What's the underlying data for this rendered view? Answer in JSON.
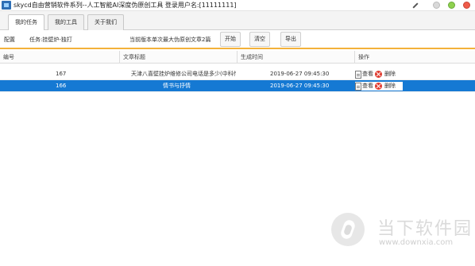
{
  "window": {
    "title": "skycd自由营销软件系列--人工智能AI深度伪原创工具 登录用户名:[11111111]"
  },
  "tabs": [
    {
      "label": "我的任务"
    },
    {
      "label": "我的工具"
    },
    {
      "label": "关于我们"
    }
  ],
  "toolbar": {
    "config_label": "配置",
    "task_label": "任务:挂壁炉-独打",
    "info_text": "当前版本单次最大伪原创文章2篇",
    "start_label": "开始",
    "clear_label": "清空",
    "export_label": "导出"
  },
  "table": {
    "columns": [
      "编号",
      "文章标题",
      "生成时间",
      "操作"
    ],
    "rows": [
      {
        "id": "167",
        "title": "天津八喜壁挂炉维修公司电话是多少(中科传...",
        "time": "2019-06-27  09:45:30",
        "view": "查看",
        "delete": "删除",
        "selected": false
      },
      {
        "id": "166",
        "title": "情书与抒情",
        "time": "2019-06-27  09:45:30",
        "view": "查看",
        "delete": "删除",
        "selected": true
      }
    ]
  },
  "watermark": {
    "title": "当下软件园",
    "url": "www.downxia.com"
  },
  "colors": {
    "selection": "#1579d3",
    "toolbar_accent": "#f3b13a",
    "delete": "#e03a2e"
  }
}
